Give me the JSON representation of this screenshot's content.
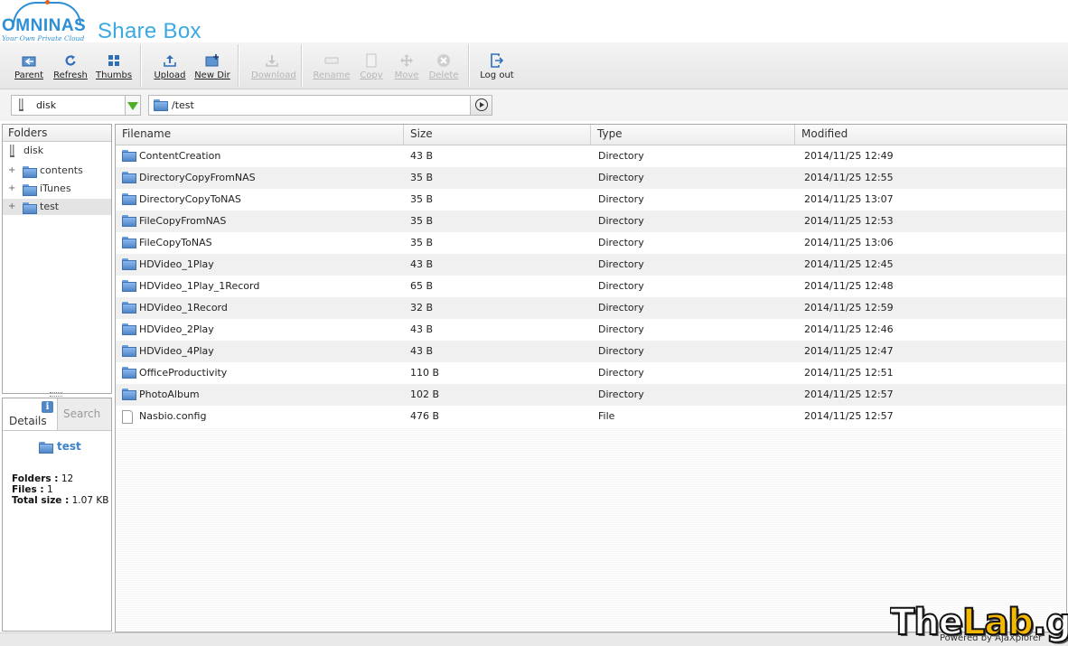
{
  "header": {
    "logo_text": "OMNINAS",
    "logo_tagline": "Your Own Private Cloud",
    "app_title": "Share Box"
  },
  "toolbar": {
    "parent": "Parent",
    "refresh": "Refresh",
    "thumbs": "Thumbs",
    "upload": "Upload",
    "new_dir": "New Dir",
    "download": "Download",
    "rename": "Rename",
    "copy": "Copy",
    "move": "Move",
    "delete": "Delete",
    "logout": "Log out"
  },
  "address": {
    "drive": "disk",
    "path": "/test"
  },
  "folders_panel": {
    "title": "Folders",
    "root": "disk",
    "items": [
      {
        "label": "contents",
        "expander": "+"
      },
      {
        "label": "iTunes",
        "expander": "+"
      },
      {
        "label": "test",
        "expander": "+",
        "selected": true
      }
    ]
  },
  "details": {
    "tab_details": "Details",
    "tab_search": "Search",
    "info_glyph": "i",
    "name": "test",
    "folders_label": "Folders :",
    "folders_value": "12",
    "files_label": "Files :",
    "files_value": "1",
    "total_label": "Total size :",
    "total_value": "1.07 KB"
  },
  "file_list": {
    "columns": {
      "filename": "Filename",
      "size": "Size",
      "type": "Type",
      "modified": "Modified"
    },
    "rows": [
      {
        "name": "ContentCreation",
        "size": "43 B",
        "type": "Directory",
        "modified": "2014/11/25 12:49",
        "icon": "folder-icon"
      },
      {
        "name": "DirectoryCopyFromNAS",
        "size": "35 B",
        "type": "Directory",
        "modified": "2014/11/25 12:55",
        "icon": "folder-icon"
      },
      {
        "name": "DirectoryCopyToNAS",
        "size": "35 B",
        "type": "Directory",
        "modified": "2014/11/25 13:07",
        "icon": "folder-icon"
      },
      {
        "name": "FileCopyFromNAS",
        "size": "35 B",
        "type": "Directory",
        "modified": "2014/11/25 12:53",
        "icon": "folder-icon"
      },
      {
        "name": "FileCopyToNAS",
        "size": "35 B",
        "type": "Directory",
        "modified": "2014/11/25 13:06",
        "icon": "folder-icon"
      },
      {
        "name": "HDVideo_1Play",
        "size": "43 B",
        "type": "Directory",
        "modified": "2014/11/25 12:45",
        "icon": "folder-icon"
      },
      {
        "name": "HDVideo_1Play_1Record",
        "size": "65 B",
        "type": "Directory",
        "modified": "2014/11/25 12:48",
        "icon": "folder-icon"
      },
      {
        "name": "HDVideo_1Record",
        "size": "32 B",
        "type": "Directory",
        "modified": "2014/11/25 12:59",
        "icon": "folder-icon"
      },
      {
        "name": "HDVideo_2Play",
        "size": "43 B",
        "type": "Directory",
        "modified": "2014/11/25 12:46",
        "icon": "folder-icon"
      },
      {
        "name": "HDVideo_4Play",
        "size": "43 B",
        "type": "Directory",
        "modified": "2014/11/25 12:47",
        "icon": "folder-icon"
      },
      {
        "name": "OfficeProductivity",
        "size": "110 B",
        "type": "Directory",
        "modified": "2014/11/25 12:51",
        "icon": "folder-icon"
      },
      {
        "name": "PhotoAlbum",
        "size": "102 B",
        "type": "Directory",
        "modified": "2014/11/25 12:57",
        "icon": "folder-icon"
      },
      {
        "name": "Nasbio.config",
        "size": "476 B",
        "type": "File",
        "modified": "2014/11/25 12:57",
        "icon": "file-icon"
      }
    ]
  },
  "statusbar": {
    "powered_by": "Powered by AjaXplorer"
  },
  "watermark": {
    "part1": "The",
    "part2": "Lab",
    "part3": ".gr"
  },
  "colors": {
    "brand_blue": "#2d8fd6",
    "title_blue": "#3aa9e3",
    "accent_orange": "#e8601c",
    "dropdown_green": "#4caf22",
    "folder_blue": "#4f86c6"
  }
}
